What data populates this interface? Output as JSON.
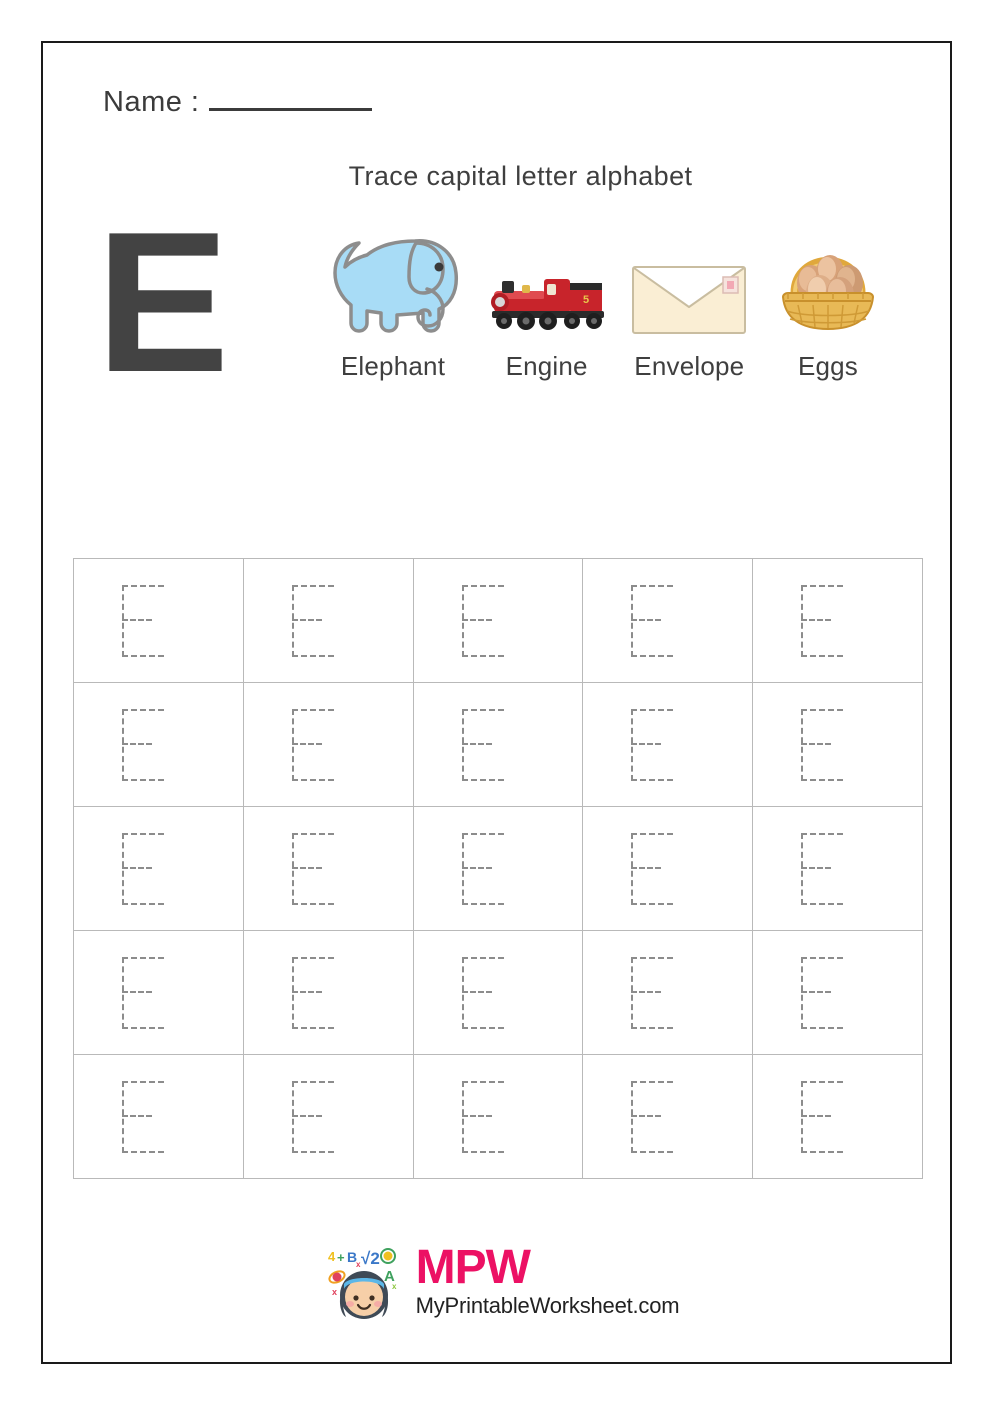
{
  "page": {
    "name_field": {
      "label": "Name :",
      "value": "",
      "placeholder": ""
    },
    "title": "Trace capital letter alphabet",
    "letter": "E"
  },
  "showcase": {
    "items": [
      {
        "icon": "elephant-icon",
        "label": "Elephant",
        "color": "#a8dcf6"
      },
      {
        "icon": "train-engine-icon",
        "label": "Engine",
        "color": "#c8242b"
      },
      {
        "icon": "envelope-icon",
        "label": "Envelope",
        "color": "#f7e9c8"
      },
      {
        "icon": "eggs-basket-icon",
        "label": "Eggs",
        "color": "#e0a83c"
      }
    ]
  },
  "trace_grid": {
    "rows": 5,
    "columns": 5,
    "trace_letter": "E",
    "cells": [
      [
        "E",
        "E",
        "E",
        "E",
        "E"
      ],
      [
        "E",
        "E",
        "E",
        "E",
        "E"
      ],
      [
        "E",
        "E",
        "E",
        "E",
        "E"
      ],
      [
        "E",
        "E",
        "E",
        "E",
        "E"
      ],
      [
        "E",
        "E",
        "E",
        "E",
        "E"
      ]
    ]
  },
  "footer": {
    "brand": "MPW",
    "site": "MyPrintableWorksheet.com",
    "brand_color": "#ec1164",
    "logo_symbols": [
      "4+B",
      "√2",
      "A",
      "x"
    ]
  }
}
